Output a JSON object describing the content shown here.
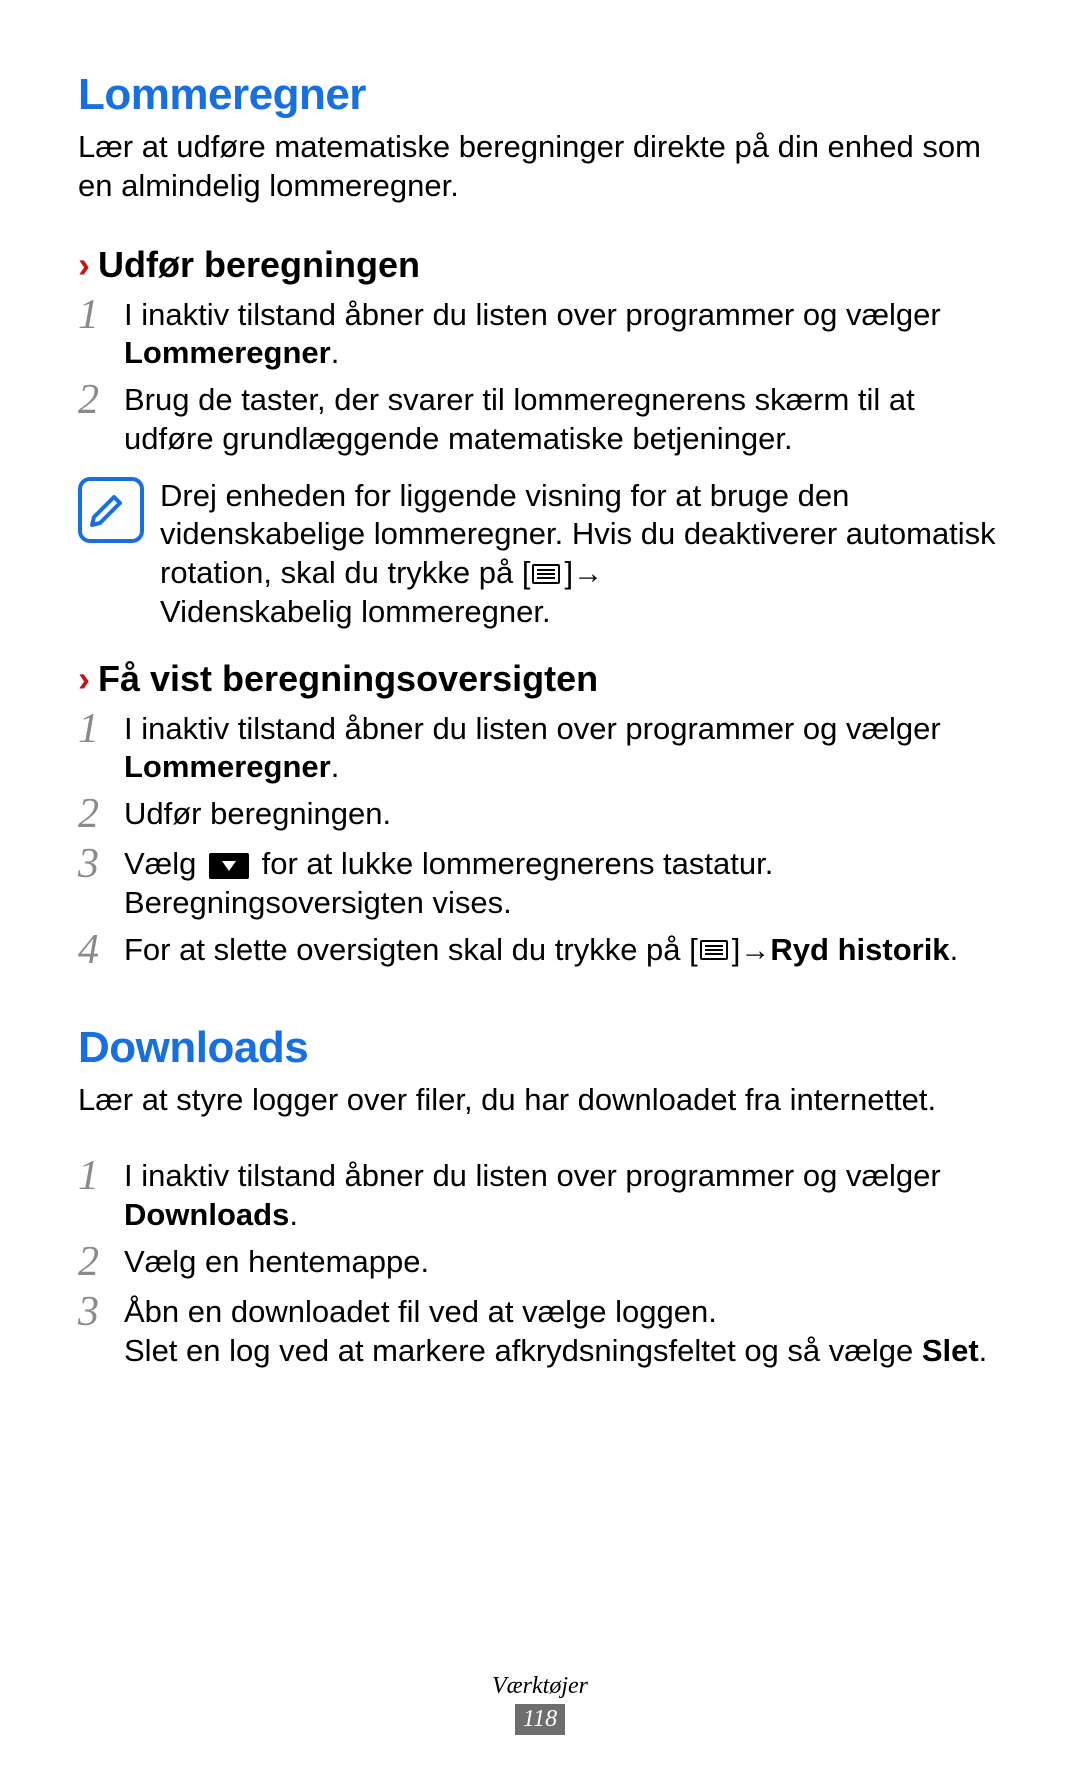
{
  "section1": {
    "title": "Lommeregner",
    "intro": "Lær at udføre matematiske beregninger direkte på din enhed som en almindelig lommeregner.",
    "sub1": {
      "heading": "Udfør beregningen",
      "step1_pre": "I inaktiv tilstand åbner du listen over programmer og vælger ",
      "step1_strong": "Lommeregner",
      "step1_post": ".",
      "step2": "Brug de taster, der svarer til lommeregnerens skærm til at udføre grundlæggende matematiske betjeninger.",
      "note_pre": "Drej enheden for liggende visning for at bruge den videnskabelige lommeregner. Hvis du deaktiverer automatisk rotation, skal du trykke på ",
      "note_bracket_open": "[",
      "note_bracket_close": "]",
      "note_arrow": " → ",
      "note_strong": "Videnskabelig lommeregner",
      "note_post": "."
    },
    "sub2": {
      "heading": "Få vist beregningsoversigten",
      "step1_pre": "I inaktiv tilstand åbner du listen over programmer og vælger ",
      "step1_strong": "Lommeregner",
      "step1_post": ".",
      "step2": "Udfør beregningen.",
      "step3_pre": "Vælg ",
      "step3_mid": " for at lukke lommeregnerens tastatur. Beregningsoversigten vises.",
      "step4_pre": "For at slette oversigten skal du trykke på ",
      "step4_bracket_open": "[",
      "step4_bracket_close": "]",
      "step4_arrow": " → ",
      "step4_strong": "Ryd historik",
      "step4_post": "."
    }
  },
  "section2": {
    "title": "Downloads",
    "intro": "Lær at styre logger over filer, du har downloadet fra internettet.",
    "step1_pre": "I inaktiv tilstand åbner du listen over programmer og vælger ",
    "step1_strong": "Downloads",
    "step1_post": ".",
    "step2": "Vælg en hentemappe.",
    "step3_line1": "Åbn en downloadet fil ved at vælge loggen.",
    "step3_line2_pre": "Slet en log ved at markere afkrydsningsfeltet og så vælge ",
    "step3_line2_strong": "Slet",
    "step3_line2_post": "."
  },
  "footer": {
    "category": "Værktøjer",
    "page": "118"
  },
  "numerals": {
    "n1": "1",
    "n2": "2",
    "n3": "3",
    "n4": "4"
  },
  "chevron": "›"
}
